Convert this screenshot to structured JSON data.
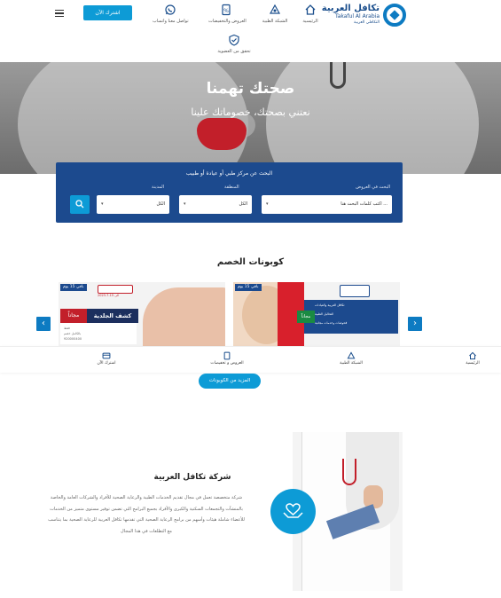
{
  "header": {
    "logo": {
      "arabic": "تكافل العربية",
      "latin": "Takaful Al Arabia",
      "tagline": "التكافلي العربية"
    },
    "nav": [
      {
        "label": "الرئيسية",
        "icon": "home-icon"
      },
      {
        "label": "الشبكة الطبية",
        "icon": "medical-network-icon"
      },
      {
        "label": "العروض والتخفيضات",
        "icon": "offers-icon"
      },
      {
        "label": "تواصل معنا واتساب",
        "icon": "whatsapp-icon"
      },
      {
        "label": "تحقق من العضوية",
        "icon": "shield-check-icon"
      }
    ],
    "join_button": "اشترك الآن"
  },
  "hero": {
    "title": "صحتك تهمنا",
    "subtitle": "نعتني بصحتك، خصوماتك علينا"
  },
  "search": {
    "heading": "البحث عن مركز طبي أو عيادة أو طبيب",
    "fields": [
      {
        "label": "البحث في العروض",
        "value": "اكتب كلمات البحث هنا ..."
      },
      {
        "label": "المنطقة",
        "value": "الكل"
      },
      {
        "label": "المدينة",
        "value": "الكل"
      }
    ]
  },
  "coupons": {
    "title": "كوبونات الخصم",
    "cards": [
      {
        "tag": "باقي 15 يوم",
        "free": "مجاناً",
        "headline": "كشف الجلدية",
        "lines": [
          "فقط",
          "بالكامل خصم",
          "920000400"
        ],
        "date": "2023-7-15 الى"
      },
      {
        "tag": "باقي 15 يوم",
        "free": "مجاناً",
        "lines": [
          "تكافل العربية والعيادات",
          "التحاليل الطبية",
          "فحوصات وخدمات مجانية"
        ]
      }
    ],
    "more_button": "المزيد من الكوبونات"
  },
  "bottom_nav": [
    {
      "label": "الرئيسية",
      "icon": "home-icon"
    },
    {
      "label": "الشبكة الطبية",
      "icon": "medical-network-icon"
    },
    {
      "label": "العروض و تخفيضات",
      "icon": "offers-icon"
    },
    {
      "label": "اشترك الآن",
      "icon": "card-icon"
    }
  ],
  "about": {
    "title": "شركة تكافل العربية",
    "text": "شركة متخصصة تعمل في مجال تقديم الخدمات الطبية والرعاية الصحية للأفراد والشركات العامة والخاصة بالمنشآت والتجمعات السكنية والكبرى والأفراد بجميع البرامج التي تضمن توفير مستوى متميز من الخدمات للأعضاء شاملة هيئات وأسهم من برامج الرعاية الصحية التي تقدمها تكافل العربية للرعاية الصحية بما يتناسب مع التطلعات في هذا المجال"
  },
  "colors": {
    "primary": "#1c4a8e",
    "accent": "#0d9bd6",
    "red": "#c21f2a"
  }
}
